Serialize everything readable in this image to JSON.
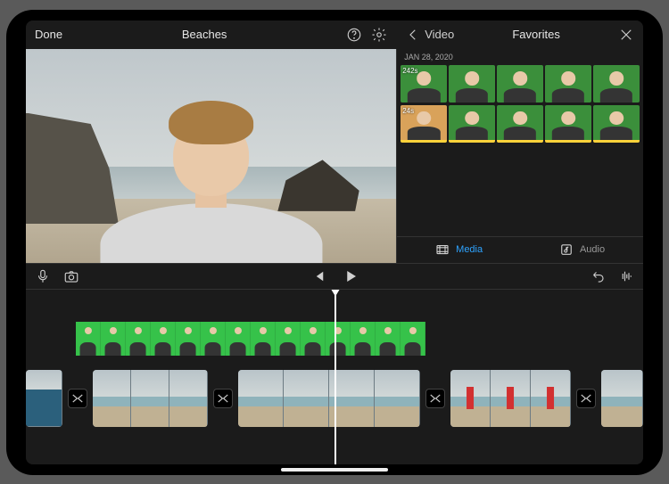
{
  "header": {
    "done_label": "Done",
    "project_title": "Beaches"
  },
  "library": {
    "back_label": "Video",
    "panel_title": "Favorites",
    "date_label": "JAN 28, 2020",
    "row1_duration": "242s",
    "row2_duration": "24s",
    "tabs": {
      "media": "Media",
      "audio": "Audio"
    }
  }
}
